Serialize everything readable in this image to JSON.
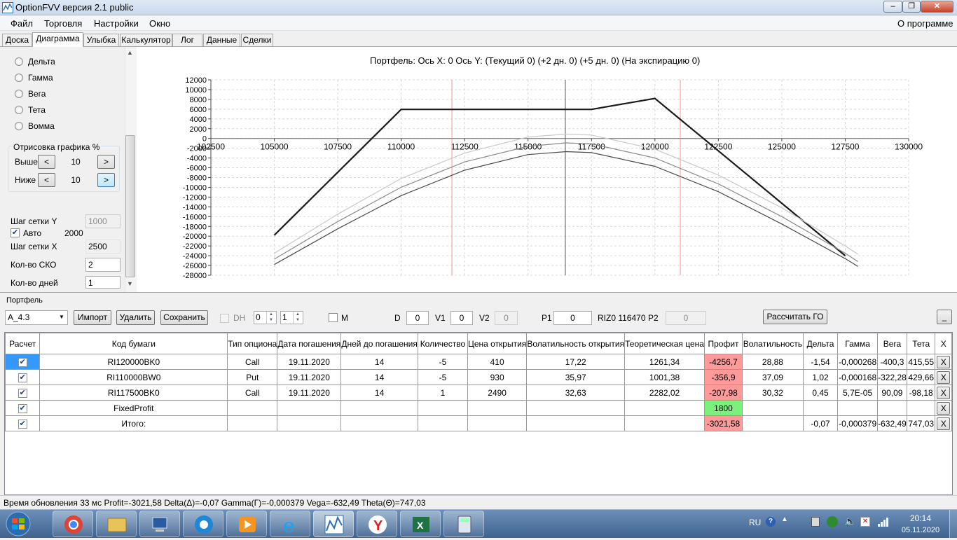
{
  "window": {
    "title": "OptionFVV версия 2.1 public"
  },
  "menu": {
    "items": [
      "Файл",
      "Торговля",
      "Настройки",
      "Окно"
    ],
    "about": "О программе"
  },
  "tabs": [
    "Доска",
    "Диаграмма",
    "Улыбка",
    "Калькулятор",
    "Лог",
    "Данные",
    "Сделки"
  ],
  "left_panel": {
    "radios": [
      "Дельта",
      "Гамма",
      "Вега",
      "Тета",
      "Вомма"
    ],
    "render_group": {
      "title": "Отрисовка графика %",
      "above_label": "Выше",
      "above_value": "10",
      "below_label": "Ниже",
      "below_value": "10",
      "dec": "<",
      "inc": ">"
    },
    "grid_y_label": "Шаг сетки Y",
    "grid_y_value": "1000",
    "auto_label": "Авто",
    "auto_value": "2000",
    "grid_x_label": "Шаг сетки X",
    "grid_x_value": "2500",
    "sko_label": "Кол-во СКО",
    "sko_value": "2",
    "days_label": "Кол-во дней",
    "days_value": "1"
  },
  "chart_data": {
    "type": "line",
    "title": "Портфель: Ось X: 0 Ось Y:  (Текущий 0)  (+2 дн. 0)  (+5 дн. 0)  (На экспирацию 0)",
    "x_ticks": [
      "102500",
      "105000",
      "107500",
      "110000",
      "112500",
      "115000",
      "117500",
      "120000",
      "122500",
      "125000",
      "127500",
      "130000"
    ],
    "y_ticks": [
      "12000",
      "10000",
      "8000",
      "6000",
      "4000",
      "2000",
      "0",
      "-2000",
      "-4000",
      "-6000",
      "-8000",
      "-10000",
      "-12000",
      "-14000",
      "-16000",
      "-18000",
      "-20000",
      "-22000",
      "-24000",
      "-26000",
      "-28000"
    ],
    "xlim": [
      102500,
      130000
    ],
    "ylim": [
      -28000,
      12000
    ],
    "vlines": [
      {
        "x": 112000,
        "color": "#ff9090"
      },
      {
        "x": 116470,
        "color": "#555555"
      },
      {
        "x": 121000,
        "color": "#ff9090"
      }
    ],
    "series": [
      {
        "color": "#1a1a1a",
        "width": 2.2,
        "points": [
          [
            105000,
            -19800
          ],
          [
            110000,
            5950
          ],
          [
            117500,
            5950
          ],
          [
            120000,
            8200
          ],
          [
            127500,
            -24000
          ]
        ]
      },
      {
        "color": "#c8c8c8",
        "width": 1.2,
        "points": [
          [
            105000,
            -23500
          ],
          [
            107500,
            -15500
          ],
          [
            110000,
            -8200
          ],
          [
            112500,
            -3000
          ],
          [
            115000,
            300
          ],
          [
            116500,
            900
          ],
          [
            117500,
            700
          ],
          [
            120000,
            -2200
          ],
          [
            122500,
            -7500
          ],
          [
            125000,
            -14200
          ],
          [
            127500,
            -22000
          ],
          [
            128000,
            -23700
          ]
        ]
      },
      {
        "color": "#8a8a8a",
        "width": 1.2,
        "points": [
          [
            105000,
            -24700
          ],
          [
            107500,
            -17000
          ],
          [
            110000,
            -10000
          ],
          [
            112500,
            -4800
          ],
          [
            115000,
            -1600
          ],
          [
            116500,
            -900
          ],
          [
            117500,
            -1100
          ],
          [
            120000,
            -4000
          ],
          [
            122500,
            -9300
          ],
          [
            125000,
            -16000
          ],
          [
            127500,
            -23500
          ],
          [
            128000,
            -25200
          ]
        ]
      },
      {
        "color": "#4a4a4a",
        "width": 1.2,
        "points": [
          [
            105000,
            -25800
          ],
          [
            107500,
            -18500
          ],
          [
            110000,
            -11700
          ],
          [
            112500,
            -6500
          ],
          [
            115000,
            -3300
          ],
          [
            116500,
            -2700
          ],
          [
            117500,
            -2900
          ],
          [
            120000,
            -5700
          ],
          [
            122500,
            -10900
          ],
          [
            125000,
            -17500
          ],
          [
            127500,
            -24600
          ],
          [
            128000,
            -26200
          ]
        ]
      }
    ]
  },
  "portfolio": {
    "title": "Портфель",
    "selected": "A_4.3",
    "import_btn": "Импорт",
    "delete_btn": "Удалить",
    "save_btn": "Сохранить",
    "dh_label": "DH",
    "dh_v1": "0",
    "dh_v2": "1",
    "m_label": "M",
    "d_label": "D",
    "d_value": "0",
    "v1_label": "V1",
    "v1_value": "0",
    "v2_label": "V2",
    "v2_value": "0",
    "p1_label": "P1",
    "p1_value": "0",
    "riz": "RIZ0 116470",
    "p2_label": "P2",
    "p2_value": "0",
    "calc_go_btn": "Рассчитать ГО",
    "min_btn": "_"
  },
  "table": {
    "headers": [
      "Расчет",
      "Код бумаги",
      "Тип опциона",
      "Дата погашения",
      "Дней до погашения",
      "Количество",
      "Цена открытия",
      "Волатильность открытия",
      "Теоретическая цена",
      "Профит",
      "Волатильность",
      "Дельта",
      "Гамма",
      "Вега",
      "Тета",
      "X"
    ],
    "rows": [
      {
        "code": "RI120000BK0",
        "type": "Call",
        "date": "19.11.2020",
        "days": "14",
        "qty": "-5",
        "price": "410",
        "vol_open": "17,22",
        "theo": "1261,34",
        "profit": "-4256,7",
        "vol": "28,88",
        "delta": "-1,54",
        "gamma": "-0,000268",
        "vega": "-400,3",
        "theta": "415,55",
        "x": "X"
      },
      {
        "code": "RI110000BW0",
        "type": "Put",
        "date": "19.11.2020",
        "days": "14",
        "qty": "-5",
        "price": "930",
        "vol_open": "35,97",
        "theo": "1001,38",
        "profit": "-356,9",
        "vol": "37,09",
        "delta": "1,02",
        "gamma": "-0,000168",
        "vega": "-322,28",
        "theta": "429,66",
        "x": "X"
      },
      {
        "code": "RI117500BK0",
        "type": "Call",
        "date": "19.11.2020",
        "days": "14",
        "qty": "1",
        "price": "2490",
        "vol_open": "32,63",
        "theo": "2282,02",
        "profit": "-207,98",
        "vol": "30,32",
        "delta": "0,45",
        "gamma": "5,7E-05",
        "vega": "90,09",
        "theta": "-98,18",
        "x": "X"
      },
      {
        "code": "FixedProfit",
        "type": "",
        "date": "",
        "days": "",
        "qty": "",
        "price": "",
        "vol_open": "",
        "theo": "",
        "profit": "1800",
        "vol": "",
        "delta": "",
        "gamma": "",
        "vega": "",
        "theta": "",
        "x": "X"
      },
      {
        "code": "Итого:",
        "type": "",
        "date": "",
        "days": "",
        "qty": "",
        "price": "",
        "vol_open": "",
        "theo": "",
        "profit": "-3021,58",
        "vol": "",
        "delta": "-0,07",
        "gamma": "-0,000379",
        "vega": "-632,49",
        "theta": "747,03",
        "x": "X"
      }
    ]
  },
  "status": "Время обновления 33 мс  Profit=-3021,58 Delta(Δ)=-0,07 Gamma(Γ)=-0,000379 Vega=-632,49 Theta(Θ)=747,03",
  "taskbar": {
    "lang": "RU",
    "time": "20:14",
    "date": "05.11.2020",
    "apps": [
      "chrome-icon",
      "explorer-icon",
      "network-icon",
      "edge-icon",
      "media-icon",
      "ie-icon",
      "optionfvv-icon",
      "yandex-icon",
      "excel-icon",
      "calculator-icon"
    ]
  }
}
